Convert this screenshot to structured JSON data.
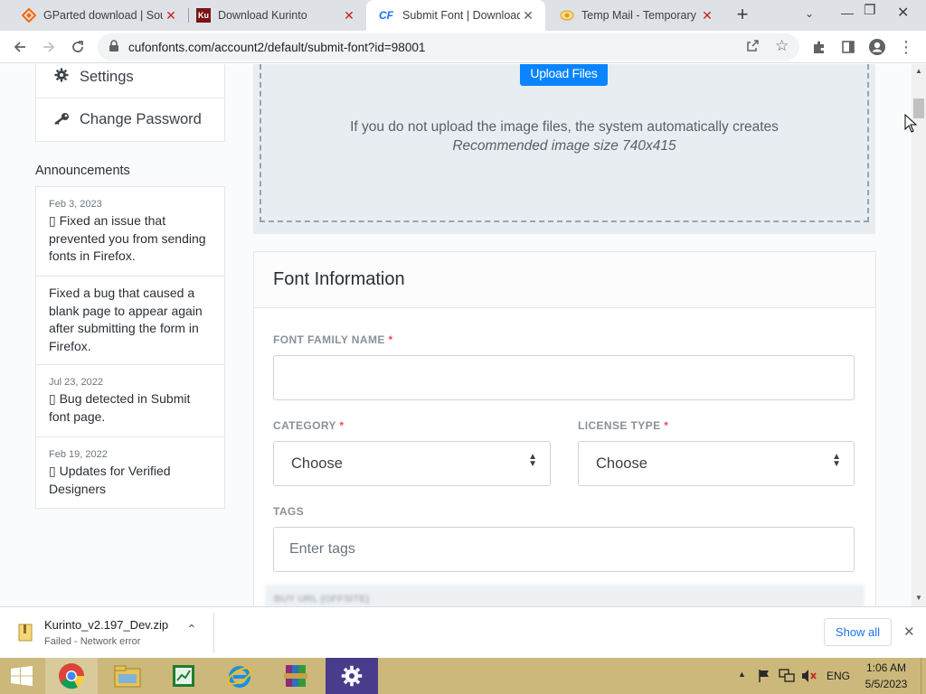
{
  "browser": {
    "tabs": [
      {
        "title": "GParted download | Sour",
        "favicon": "sourceforge-icon",
        "favicon_color": "#ff6600"
      },
      {
        "title": "Download Kurinto",
        "favicon": "kurinto-icon",
        "favicon_text": "Ku",
        "favicon_color": "#b71c1c"
      },
      {
        "title": "Submit Font | Download",
        "favicon": "cufonfonts-icon",
        "favicon_text": "CF",
        "favicon_color": "#1a73e8"
      },
      {
        "title": "Temp Mail - Temporary D",
        "favicon": "tempmail-icon",
        "favicon_color": "#e7a000"
      }
    ],
    "active_tab": 2,
    "url": "cufonfonts.com/account2/default/submit-font?id=98001"
  },
  "sidebar": {
    "links": [
      {
        "label": "Settings",
        "icon": "gear-icon"
      },
      {
        "label": "Change Password",
        "icon": "key-icon"
      }
    ],
    "announcements_heading": "Announcements",
    "announcements": [
      {
        "date": "Feb 3, 2023",
        "text": "▯ Fixed an issue that prevented you from sending fonts in Firefox."
      },
      {
        "date": "",
        "text": "Fixed a bug that caused a blank page to appear again after submitting the form in Firefox."
      },
      {
        "date": "Jul 23, 2022",
        "text": "▯ Bug detected in Submit font page."
      },
      {
        "date": "Feb 19, 2022",
        "text": "▯ Updates for Verified Designers"
      }
    ]
  },
  "upload": {
    "button_label": "Upload Files",
    "info_line": "If you do not upload the image files, the system automatically creates",
    "size_hint": "Recommended image size 740x415"
  },
  "font_info": {
    "heading": "Font Information",
    "family_label": "FONT FAMILY NAME",
    "family_value": "",
    "category_label": "CATEGORY",
    "category_value": "Choose",
    "license_label": "LICENSE TYPE",
    "license_value": "Choose",
    "tags_label": "TAGS",
    "tags_placeholder": "Enter tags",
    "required_mark": "*",
    "next_label_partial": "BUY URL (OFFSITE)"
  },
  "download_bar": {
    "filename": "Kurinto_v2.197_Dev.zip",
    "status": "Failed - Network error",
    "show_all": "Show all"
  },
  "taskbar": {
    "apps": [
      "chrome-icon",
      "file-explorer-icon",
      "spreadsheet-icon",
      "internet-explorer-icon",
      "winrar-icon",
      "settings-app-icon"
    ],
    "language": "ENG",
    "time": "1:06 AM",
    "date": "5/5/2023"
  },
  "colors": {
    "accent": "#1a73e8",
    "upload_button": "#0a84ff",
    "required": "#e55353",
    "taskbar": "#cbb87a"
  }
}
